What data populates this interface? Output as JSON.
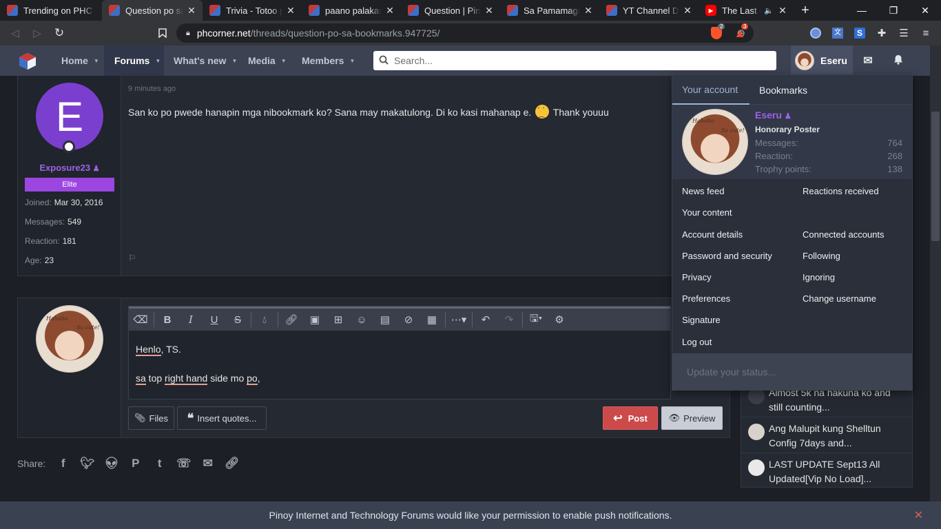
{
  "browser": {
    "tabs": [
      {
        "title": "Trending on PHC",
        "favicon": "phc-favicon-icon"
      },
      {
        "title": "Question po sa B",
        "favicon": "phc-favicon-icon",
        "active": true
      },
      {
        "title": "Trivia - Totoo po",
        "favicon": "phc-favicon-icon"
      },
      {
        "title": "paano palakasin",
        "favicon": "phc-favicon-icon"
      },
      {
        "title": "Question | Pinoy",
        "favicon": "phc-favicon-icon"
      },
      {
        "title": "Sa Pamamagitan",
        "favicon": "phc-favicon-icon"
      },
      {
        "title": "YT Channel Dow",
        "favicon": "phc-favicon-icon"
      },
      {
        "title": "The Last of U",
        "favicon": "youtube-icon"
      }
    ],
    "url_host": "phcorner.net",
    "url_path": "/threads/question-po-sa-bookmarks.947725/",
    "brave_badge": "2",
    "alert_badge": "3"
  },
  "nav": {
    "home": "Home",
    "forums": "Forums",
    "whats_new": "What's new",
    "media": "Media",
    "members": "Members",
    "search_placeholder": "Search...",
    "username": "Eseru"
  },
  "post": {
    "timestamp": "9 minutes ago",
    "body_before": "San ko po pwede hanapin mga nibookmark ko? Sana may makatulong. Di ko kasi mahanap e.",
    "body_after": "Thank youuu",
    "author": {
      "initial": "E",
      "name": "Exposure23",
      "badge": "Elite",
      "joined_label": "Joined:",
      "joined": "Mar 30, 2016",
      "messages_label": "Messages:",
      "messages": "549",
      "reaction_label": "Reaction:",
      "reaction": "181",
      "age_label": "Age:",
      "age": "23"
    }
  },
  "reply": {
    "line1_a": "Henlo",
    "line1_b": ", TS.",
    "line2_a": "sa",
    "line2_b": " top ",
    "line2_c": "right hand",
    "line2_d": " side mo ",
    "line2_e": "po",
    "line2_f": ",",
    "files": "Files",
    "insert_quotes": "Insert quotes...",
    "post": "Post",
    "preview": "Preview"
  },
  "share": {
    "label": "Share:"
  },
  "sidebar": {
    "items": [
      "Almost 5k na hakuna ko and still counting...",
      "Ang Malupit kung Shelltun Config 7days and...",
      "LAST UPDATE Sept13 All Updated[Vip No Load]..."
    ]
  },
  "account": {
    "tab_account": "Your account",
    "tab_bookmarks": "Bookmarks",
    "name": "Eseru",
    "title": "Honorary Poster",
    "messages_label": "Messages:",
    "messages": "764",
    "reaction_label": "Reaction:",
    "reaction": "268",
    "trophy_label": "Trophy points:",
    "trophy": "138",
    "links_left": [
      "News feed",
      "Your content",
      "Account details",
      "Password and security",
      "Privacy",
      "Preferences",
      "Signature",
      "Log out"
    ],
    "links_right": [
      "Reactions received",
      "Connected accounts",
      "Following",
      "Ignoring",
      "Change username"
    ],
    "status_placeholder": "Update your status..."
  },
  "avatar_text": {
    "a": "Hahaha",
    "b": "So cute!"
  },
  "banner": "Pinoy Internet and Technology Forums would like your permission to enable push notifications.",
  "colors": {
    "accent_purple": "#9d62e8",
    "post_button": "#cc4a4a",
    "nav_bg": "#3c4252"
  }
}
